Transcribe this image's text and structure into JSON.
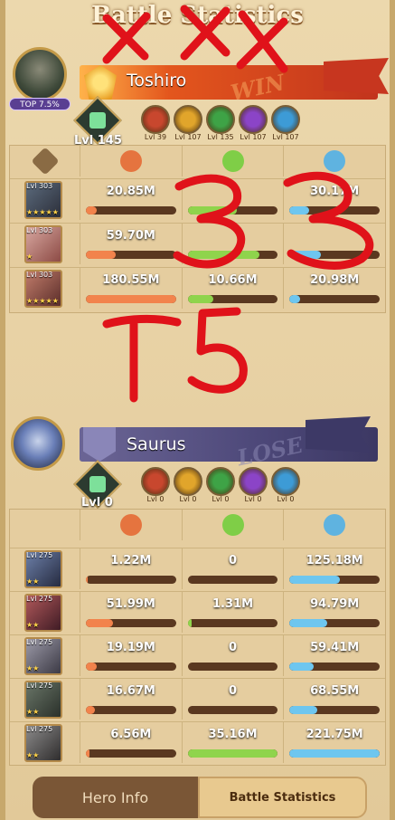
{
  "title": "Battle Statistics",
  "team1": {
    "player_name": "Toshiro",
    "result": "WIN",
    "rank_badge": "TOP 7.5%",
    "team_level": "Lvl 145",
    "beasts": [
      {
        "level": "Lvl 39",
        "color": "#c8472e"
      },
      {
        "level": "Lvl 107",
        "color": "#e1a52b"
      },
      {
        "level": "Lvl 135",
        "color": "#3ea346"
      },
      {
        "level": "Lvl 107",
        "color": "#8b44c7"
      },
      {
        "level": "Lvl 107",
        "color": "#3d9bd6"
      }
    ],
    "rows": [
      {
        "hero_level": "Lvl 303",
        "stars": "★★★★★",
        "damage": "20.85M",
        "damage_frac": 0.12,
        "healing": "",
        "healing_frac": 0.55,
        "tank": "30.17M",
        "tank_frac": 0.22
      },
      {
        "hero_level": "Lvl 303",
        "stars": "★",
        "damage": "59.70M",
        "damage_frac": 0.33,
        "healing": "",
        "healing_frac": 0.8,
        "tank": "",
        "tank_frac": 0.35
      },
      {
        "hero_level": "Lvl 303",
        "stars": "★★★★★",
        "damage": "180.55M",
        "damage_frac": 1.0,
        "healing": "10.66M",
        "healing_frac": 0.28,
        "tank": "20.98M",
        "tank_frac": 0.12
      }
    ]
  },
  "team2": {
    "player_name": "Saurus",
    "result": "LOSE",
    "team_level": "Lvl 0",
    "beasts": [
      {
        "level": "Lvl 0",
        "color": "#c8472e"
      },
      {
        "level": "Lvl 0",
        "color": "#e1a52b"
      },
      {
        "level": "Lvl 0",
        "color": "#3ea346"
      },
      {
        "level": "Lvl 0",
        "color": "#8b44c7"
      },
      {
        "level": "Lvl 0",
        "color": "#3d9bd6"
      }
    ],
    "rows": [
      {
        "hero_level": "Lvl 275",
        "stars": "★★",
        "damage": "1.22M",
        "damage_frac": 0.02,
        "healing": "0",
        "healing_frac": 0.0,
        "tank": "125.18M",
        "tank_frac": 0.56
      },
      {
        "hero_level": "Lvl 275",
        "stars": "★★",
        "damage": "51.99M",
        "damage_frac": 0.3,
        "healing": "1.31M",
        "healing_frac": 0.04,
        "tank": "94.79M",
        "tank_frac": 0.42
      },
      {
        "hero_level": "Lvl 275",
        "stars": "★★",
        "damage": "19.19M",
        "damage_frac": 0.12,
        "healing": "0",
        "healing_frac": 0.0,
        "tank": "59.41M",
        "tank_frac": 0.27
      },
      {
        "hero_level": "Lvl 275",
        "stars": "★★",
        "damage": "16.67M",
        "damage_frac": 0.1,
        "healing": "0",
        "healing_frac": 0.0,
        "tank": "68.55M",
        "tank_frac": 0.31
      },
      {
        "hero_level": "Lvl 275",
        "stars": "★★",
        "damage": "6.56M",
        "damage_frac": 0.04,
        "healing": "35.16M",
        "healing_frac": 1.0,
        "tank": "221.75M",
        "tank_frac": 1.0
      }
    ]
  },
  "icons": {
    "damage": "skull-icon",
    "healing": "heal-icon",
    "tank": "shield-icon"
  },
  "tabs": {
    "hero_info": "Hero Info",
    "battle_statistics": "Battle Statistics"
  }
}
